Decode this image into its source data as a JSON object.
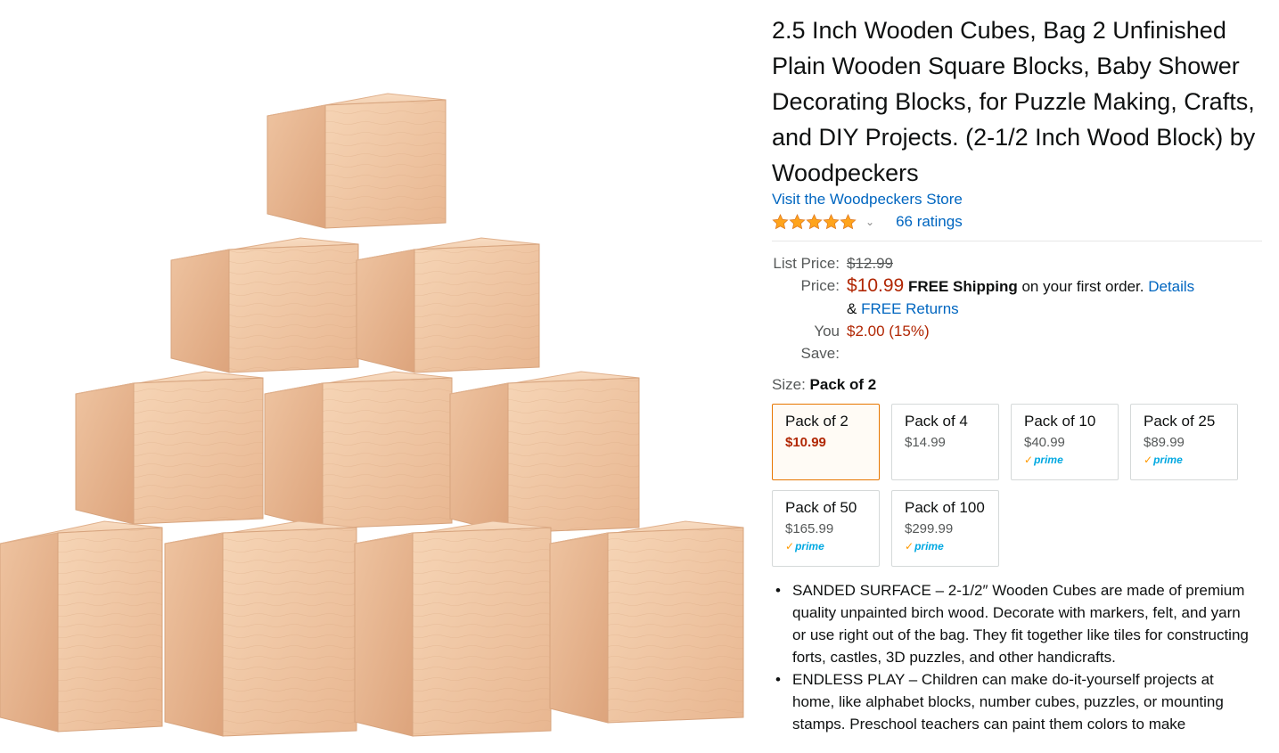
{
  "product": {
    "title": "2.5 Inch Wooden Cubes, Bag 2 Unfinished Plain Wooden Square Blocks, Baby Shower Decorating Blocks, for Puzzle Making, Crafts, and DIY Projects. (2-1/2 Inch Wood Block) by Woodpeckers",
    "store_link": "Visit the Woodpeckers Store",
    "rating_stars": 5,
    "ratings_count": "66 ratings"
  },
  "pricing": {
    "list_price_label": "List Price:",
    "list_price": "$12.99",
    "price_label": "Price:",
    "price": "$10.99",
    "free_shipping": "FREE Shipping",
    "shipping_note": " on your first order.",
    "details_link": "Details",
    "returns_prefix": "& ",
    "returns_link": "FREE Returns",
    "you_save_label": "You Save:",
    "you_save": "$2.00 (15%)"
  },
  "size": {
    "label": "Size:",
    "selected": "Pack of 2",
    "options": [
      {
        "name": "Pack of 2",
        "price": "$10.99",
        "prime": ""
      },
      {
        "name": "Pack of 4",
        "price": "$14.99",
        "prime": ""
      },
      {
        "name": "Pack of 10",
        "price": "$40.99",
        "prime": "prime"
      },
      {
        "name": "Pack of 25",
        "price": "$89.99",
        "prime": "prime"
      },
      {
        "name": "Pack of 50",
        "price": "$165.99",
        "prime": "prime"
      },
      {
        "name": "Pack of 100",
        "price": "$299.99",
        "prime": "prime"
      }
    ]
  },
  "bullets": [
    "SANDED SURFACE – 2-1/2″ Wooden Cubes are made of premium quality unpainted birch wood. Decorate with markers, felt, and yarn or use right out of the bag. They fit together like tiles for constructing forts, castles, 3D puzzles, and other handicrafts.",
    "ENDLESS PLAY – Children can make do-it-yourself projects at home, like alphabet blocks, number cubes, puzzles, or mounting stamps. Preschool teachers can paint them colors to make"
  ],
  "colors": {
    "link": "#0066c0",
    "price_red": "#b12704",
    "selected_border": "#e77600",
    "star": "#ffa41c",
    "wood_light": "#f3cfae",
    "wood_mid": "#e8b891",
    "wood_dark": "#d9a078"
  }
}
